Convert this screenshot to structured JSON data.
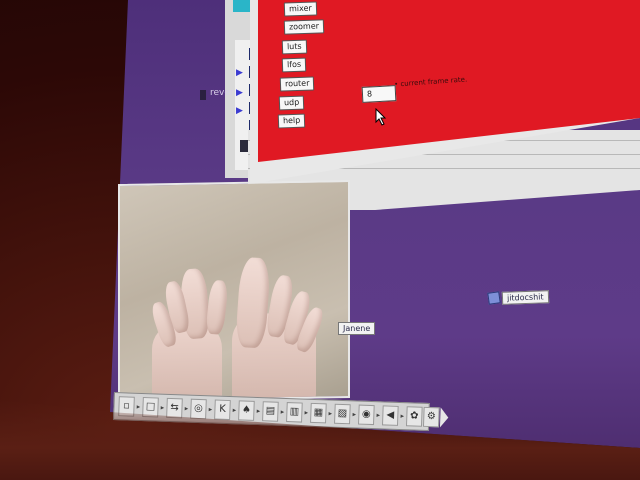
{
  "patcher": {
    "objects": [
      "mixer",
      "zoomer",
      "luts",
      "lfos",
      "router",
      "udp",
      "help"
    ],
    "number_value": "8",
    "comment": "• current frame rate."
  },
  "desktop": {
    "reverb_label": "rever",
    "video_label": "Janene",
    "doc_label": "jitdocshit"
  },
  "toolbar": {
    "icons": [
      "▫",
      "□",
      "⇆",
      "◎",
      "K",
      "♠",
      "▤",
      "▥",
      "▦",
      "▧",
      "◉",
      "◀",
      "✿",
      "⚙"
    ]
  }
}
